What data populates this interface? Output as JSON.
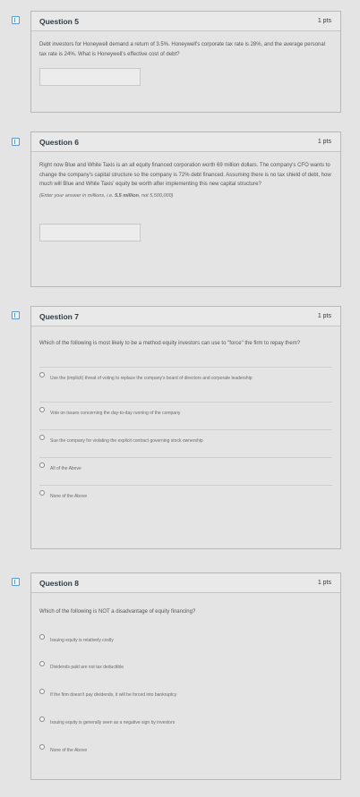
{
  "questions": [
    {
      "title": "Question 5",
      "points": "1 pts",
      "text": "Debt investors for Honeywell demand a return of 3.5%. Honeywell's corporate tax rate is 28%, and the average personal tax rate is 24%. What is Honeywell's effective cost of debt?"
    },
    {
      "title": "Question 6",
      "points": "1 pts",
      "text": "Right now Blue and White Taxis is an all equity financed corporation worth 69 million dollars. The company's CFO wants to change the company's capital structure so the company is 72% debt financed. Assuming there is no tax shield of debt, how much will Blue and White Taxis' equity be worth after implementing this new capital structure?",
      "hint_prefix": "(Enter your answer in millions, i.e. ",
      "hint_bold": "5.5 million",
      "hint_suffix": ", not 5,500,000)"
    },
    {
      "title": "Question 7",
      "points": "1 pts",
      "text": "Which of the following is most likely to be a method equity investors can use to \"force\" the firm to repay them?",
      "options": [
        "Use the (implicit) threat of voting to replace the company's board of directors and corporate leadership",
        "Vote on issues concerning the day-to-day running of the company",
        "Sue the company for violating the explicit contract governing stock ownership",
        "All of the Above",
        "None of the Above"
      ]
    },
    {
      "title": "Question 8",
      "points": "1 pts",
      "text": "Which of the following is NOT a disadvantage of equity financing?",
      "options": [
        "Issuing equity is relatively costly",
        "Dividends paid are not tax deductible",
        "If the firm doesn't pay dividends, it will be forced into bankruptcy",
        "Issuing equity is generally seen as a negative sign by investors",
        "None of the Above"
      ]
    }
  ]
}
